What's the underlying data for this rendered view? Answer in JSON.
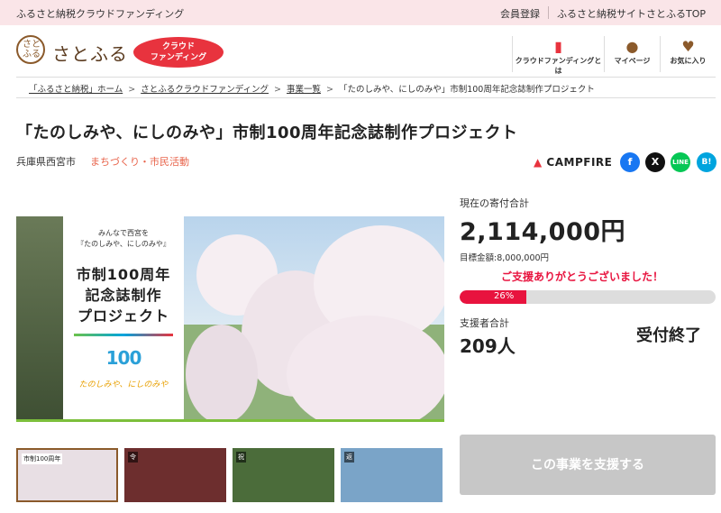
{
  "topbar": {
    "site_name": "ふるさと納税クラウドファンディング",
    "register": "会員登録",
    "top_link": "ふるさと納税サイトさとふるTOP"
  },
  "header": {
    "logo_mark": "さと\nふる",
    "logo_text": "さとふる",
    "badge_line1": "クラウド",
    "badge_line2": "ファンディング",
    "nav": [
      {
        "label": "クラウドファンディングとは",
        "icon": "book-icon"
      },
      {
        "label": "マイページ",
        "icon": "person-icon"
      },
      {
        "label": "お気に入り",
        "icon": "heart-icon"
      }
    ]
  },
  "breadcrumb": {
    "items": [
      "「ふるさと納税」ホーム",
      "さとふるクラウドファンディング",
      "事業一覧"
    ],
    "current": "「たのしみや、にしのみや」市制100周年記念誌制作プロジェクト",
    "separator": ">"
  },
  "project": {
    "title": "「たのしみや、にしのみや」市制100周年記念誌制作プロジェクト",
    "region": "兵庫県西宮市",
    "category": "まちづくり・市民活動",
    "platform": "CAMPFIRE"
  },
  "share": {
    "facebook": "f",
    "x": "X",
    "line": "LINE",
    "hatena": "B!"
  },
  "main_image": {
    "intro": "みんなで西宮を\n『たのしみや、にしのみや』",
    "headline_line1": "市制100周年",
    "headline_line2": "記念誌制作",
    "headline_line3": "プロジェクト",
    "emblem": "100",
    "script": "たのしみや、にしのみや"
  },
  "thumbnails": [
    {
      "label": "市制100周年"
    },
    {
      "label": "令"
    },
    {
      "label": "祝"
    },
    {
      "label": "返"
    }
  ],
  "stats": {
    "total_label": "現在の寄付合計",
    "total_amount": "2,114,000円",
    "goal": "目標金額:8,000,000円",
    "thanks": "ご支援ありがとうございました！",
    "progress_percent": 26,
    "progress_label": "26%",
    "supporters_label": "支援者合計",
    "supporters": "209人",
    "status": "受付終了"
  },
  "cta": {
    "support_label": "この事業を支援する"
  },
  "colors": {
    "accent_red": "#e8133e",
    "topbar_bg": "#fae5e8",
    "brand_brown": "#8b5a2b",
    "disabled_gray": "#c7c7c7"
  }
}
